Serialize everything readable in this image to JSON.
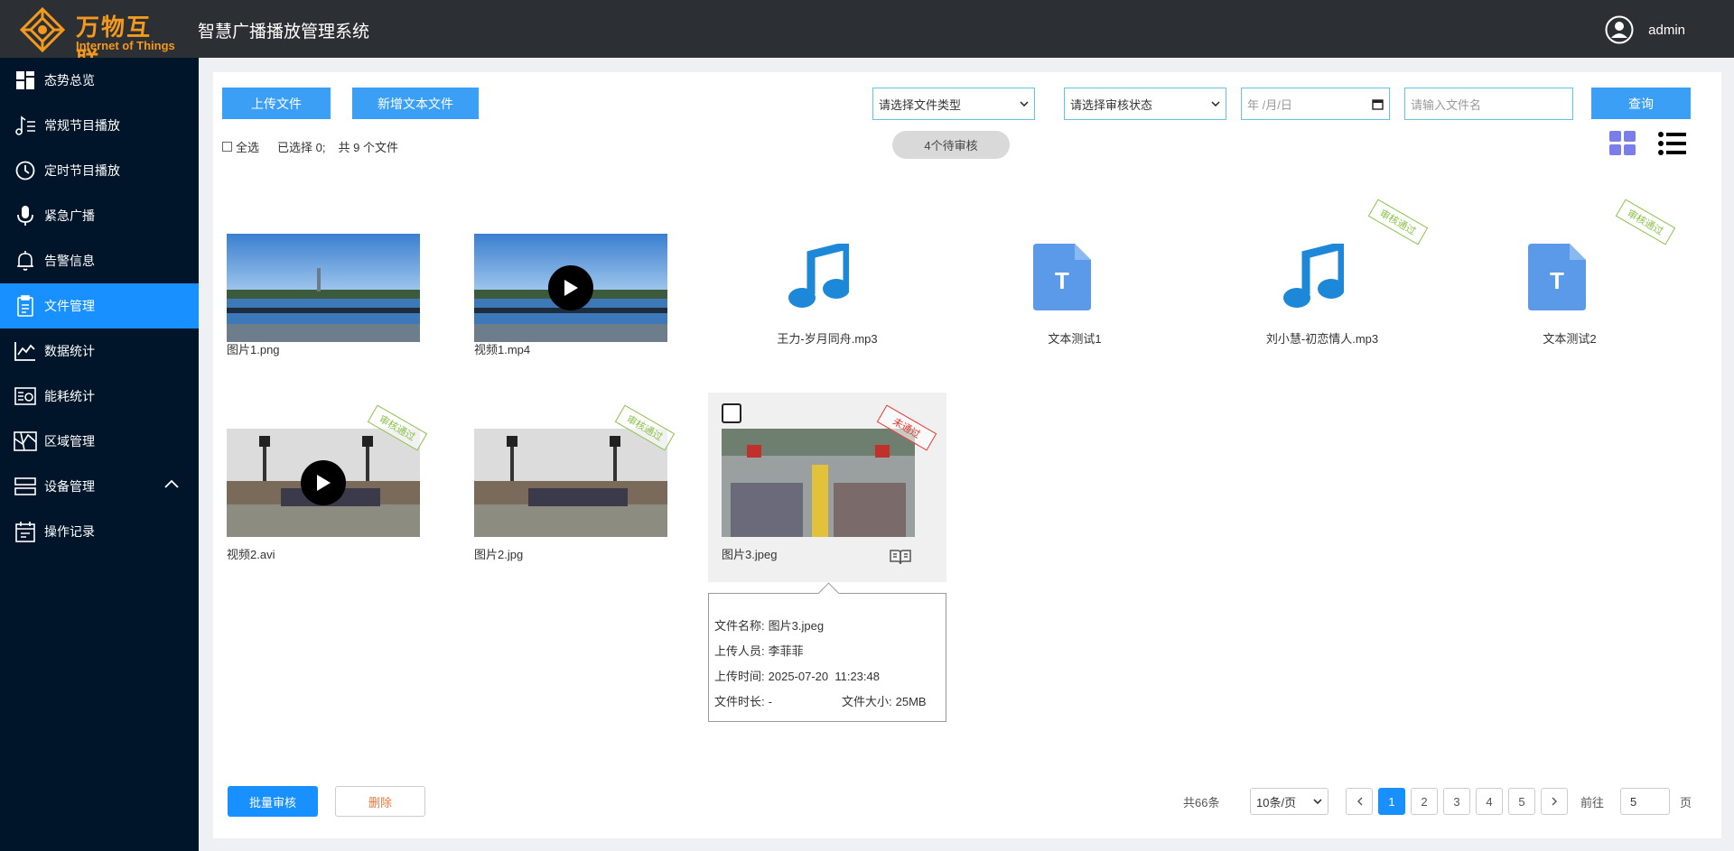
{
  "header": {
    "logo_cn": "万物互联",
    "logo_en": "Internet of Things",
    "title": "智慧广播播放管理系统",
    "user": "admin"
  },
  "sidebar": {
    "items": [
      {
        "label": "态势总览",
        "icon": "dashboard-icon"
      },
      {
        "label": "常规节目播放",
        "icon": "music-list-icon"
      },
      {
        "label": "定时节目播放",
        "icon": "clock-icon"
      },
      {
        "label": "紧急广播",
        "icon": "microphone-icon"
      },
      {
        "label": "告警信息",
        "icon": "bell-icon"
      },
      {
        "label": "文件管理",
        "icon": "file-clipboard-icon",
        "active": true
      },
      {
        "label": "数据统计",
        "icon": "line-chart-icon"
      },
      {
        "label": "能耗统计",
        "icon": "energy-icon"
      },
      {
        "label": "区域管理",
        "icon": "map-icon"
      },
      {
        "label": "设备管理",
        "icon": "device-icon",
        "expanded": true
      },
      {
        "label": "操作记录",
        "icon": "calendar-icon"
      }
    ]
  },
  "toolbar": {
    "upload_label": "上传文件",
    "new_text_label": "新增文本文件",
    "file_type_placeholder": "请选择文件类型",
    "review_status_placeholder": "请选择审核状态",
    "date_placeholder": "年 /月/日",
    "filename_placeholder": "请输入文件名",
    "query_label": "查询"
  },
  "meta": {
    "select_all": "全选",
    "selected": "已选择 0;",
    "total_files": "共 9 个文件",
    "pending": "4个待审核"
  },
  "files": [
    {
      "name": "图片1.png",
      "type": "image",
      "stamp": ""
    },
    {
      "name": "视频1.mp4",
      "type": "video",
      "stamp": ""
    },
    {
      "name": "王力-岁月同舟.mp3",
      "type": "audio",
      "stamp": ""
    },
    {
      "name": "文本测试1",
      "type": "text",
      "stamp": ""
    },
    {
      "name": "刘小慧-初恋情人.mp3",
      "type": "audio",
      "stamp": "审核通过"
    },
    {
      "name": "文本测试2",
      "type": "text",
      "stamp": "审核通过"
    },
    {
      "name": "视频2.avi",
      "type": "video",
      "stamp": "审核通过"
    },
    {
      "name": "图片2.jpg",
      "type": "image",
      "stamp": "审核通过"
    },
    {
      "name": "图片3.jpeg",
      "type": "image",
      "stamp": "未通过"
    }
  ],
  "popup": {
    "name_label": "文件名称:",
    "name_value": "图片3.jpeg",
    "uploader_label": "上传人员:",
    "uploader_value": "李菲菲",
    "time_label": "上传时间:",
    "time_value": "2025-07-20  11:23:48",
    "duration_label": "文件时长:",
    "duration_value": "-",
    "size_label": "文件大小:",
    "size_value": "25MB"
  },
  "bottom": {
    "batch_label": "批量审核",
    "delete_label": "删除"
  },
  "pagination": {
    "total": "共66条",
    "page_size": "10条/页",
    "pages": [
      "1",
      "2",
      "3",
      "4",
      "5"
    ],
    "current": "1",
    "goto_label": "前往",
    "goto_value": "5",
    "page_suffix": "页"
  },
  "colors": {
    "primary": "#1890ff",
    "sidebar_bg": "#001529",
    "header_bg": "#2c2f33",
    "logo": "#f39a1e",
    "approved": "#8bc34a",
    "rejected": "#e53935"
  }
}
